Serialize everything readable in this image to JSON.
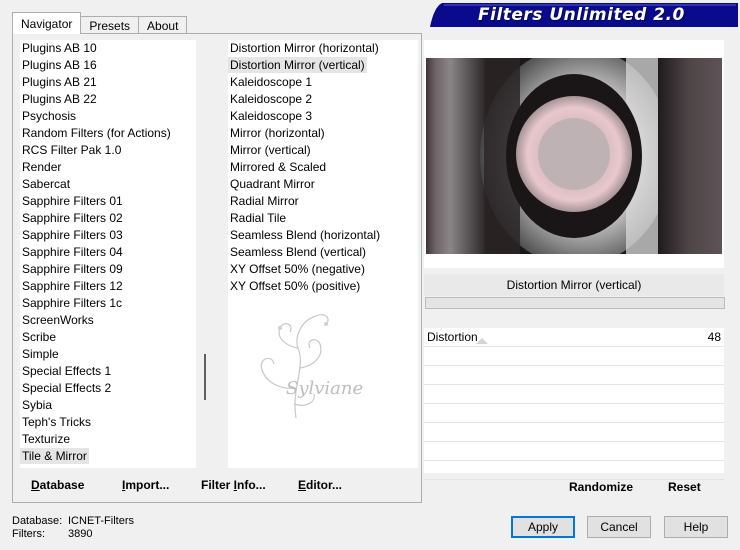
{
  "banner": {
    "title": "Filters Unlimited 2.0",
    "bg_color": "#0a0a8c"
  },
  "tabs": [
    {
      "label": "Navigator",
      "active": true
    },
    {
      "label": "Presets",
      "active": false
    },
    {
      "label": "About",
      "active": false
    }
  ],
  "categories": {
    "items": [
      "Plugins AB 10",
      "Plugins AB 16",
      "Plugins AB 21",
      "Plugins AB 22",
      "Psychosis",
      "Random Filters (for Actions)",
      "RCS Filter Pak 1.0",
      "Render",
      "Sabercat",
      "Sapphire Filters 01",
      "Sapphire Filters 02",
      "Sapphire Filters 03",
      "Sapphire Filters 04",
      "Sapphire Filters 09",
      "Sapphire Filters 12",
      "Sapphire Filters 1c",
      "ScreenWorks",
      "Scribe",
      "Simple",
      "Special Effects 1",
      "Special Effects 2",
      "Sybia",
      "Teph's Tricks",
      "Texturize",
      "Tile & Mirror"
    ],
    "selected": "Tile & Mirror"
  },
  "filters": {
    "items": [
      "Distortion Mirror (horizontal)",
      "Distortion Mirror (vertical)",
      "Kaleidoscope 1",
      "Kaleidoscope 2",
      "Kaleidoscope 3",
      "Mirror (horizontal)",
      "Mirror (vertical)",
      "Mirrored & Scaled",
      "Quadrant Mirror",
      "Radial Mirror",
      "Radial Tile",
      "Seamless Blend (horizontal)",
      "Seamless Blend (vertical)",
      "XY Offset 50% (negative)",
      "XY Offset 50% (positive)"
    ],
    "selected": "Distortion Mirror (vertical)"
  },
  "watermark": {
    "text": "Sylviane"
  },
  "left_buttons": {
    "database": {
      "u": "D",
      "rest": "atabase"
    },
    "import": {
      "u": "I",
      "rest": "mport..."
    },
    "filter_info": {
      "pre": "Filter ",
      "u": "I",
      "rest": "nfo..."
    },
    "editor": {
      "u": "E",
      "rest": "ditor..."
    }
  },
  "preview": {
    "filter_title": "Distortion Mirror (vertical)"
  },
  "params": [
    {
      "label": "Distortion",
      "value": "48",
      "level_fraction": 0.19
    }
  ],
  "right_buttons": {
    "randomize": "Randomize",
    "reset": "Reset"
  },
  "status": {
    "database_label": "Database:",
    "database_value": "ICNET-Filters",
    "filters_label": "Filters:",
    "filters_value": "3890"
  },
  "dialog": {
    "apply": "Apply",
    "cancel": "Cancel",
    "help": "Help"
  }
}
